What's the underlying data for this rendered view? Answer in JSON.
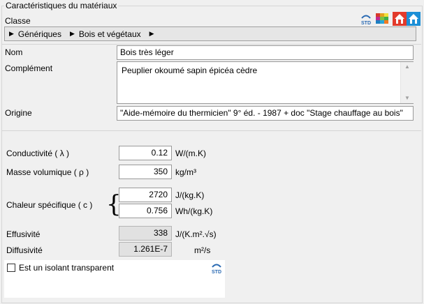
{
  "group": {
    "title": "Caractéristiques du matériaux"
  },
  "classe": {
    "label": "Classe",
    "breadcrumb": [
      "Génériques",
      "Bois et végétaux"
    ]
  },
  "fields": {
    "nom": {
      "label": "Nom",
      "value": "Bois très léger"
    },
    "complement": {
      "label": "Complément",
      "value": "Peuplier okoumé sapin épicéa cèdre"
    },
    "origine": {
      "label": "Origine",
      "value": "\"Aide-mémoire du thermicien\" 9° éd. - 1987 + doc \"Stage chauffage au bois\""
    }
  },
  "properties": {
    "conductivite": {
      "label": "Conductivité ( λ )",
      "value": "0.12",
      "unit": "W/(m.K)"
    },
    "masse": {
      "label": "Masse volumique ( ρ )",
      "value": "350",
      "unit": "kg/m³"
    },
    "chaleur": {
      "label": "Chaleur spécifique ( c )",
      "value1": "2720",
      "unit1": "J/(kg.K)",
      "value2": "0.756",
      "unit2": "Wh/(kg.K)"
    },
    "effusivite": {
      "label": "Effusivité",
      "value": "338",
      "unit": "J/(K.m².√s)"
    },
    "diffusivite": {
      "label": "Diffusivité",
      "value": "1.261E-7",
      "unit": "m²/s"
    }
  },
  "isolant": {
    "label": "Est un isolant transparent",
    "checked": false
  },
  "badges": {
    "std": "STD"
  },
  "icons": [
    "std-icon",
    "color-grid-icon",
    "house-red-icon",
    "house-blue-icon"
  ]
}
